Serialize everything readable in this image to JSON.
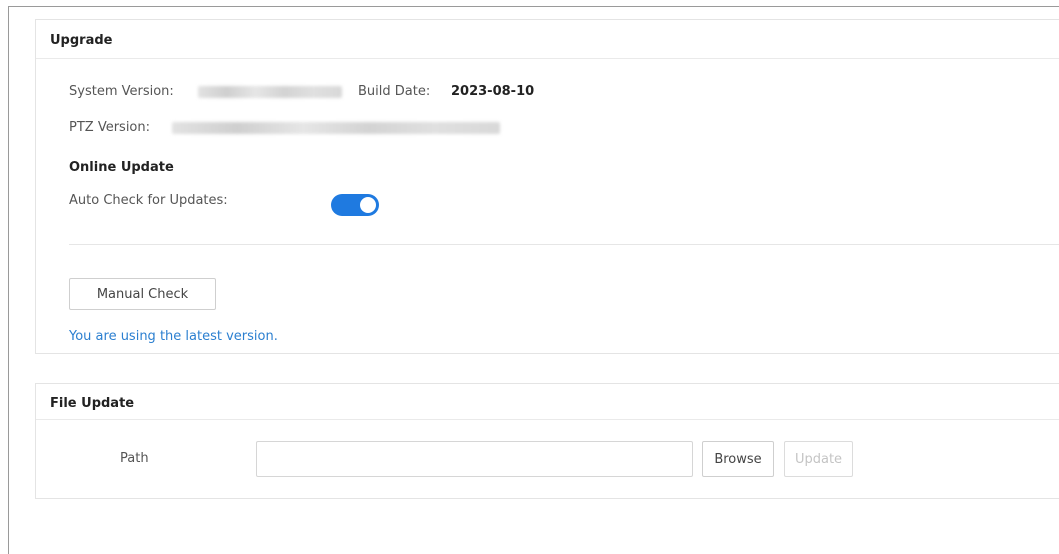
{
  "upgrade": {
    "title": "Upgrade",
    "system_version_label": "System Version:",
    "build_date_label": "Build Date:",
    "build_date_value": "2023-08-10",
    "ptz_version_label": "PTZ Version:",
    "online_update_heading": "Online Update",
    "auto_check_label": "Auto Check for Updates:",
    "auto_check_enabled": true,
    "manual_check_label": "Manual Check",
    "status_message": "You are using the latest version."
  },
  "file_update": {
    "title": "File Update",
    "path_label": "Path",
    "path_value": "",
    "browse_label": "Browse",
    "update_label": "Update"
  },
  "colors": {
    "accent": "#1f7ae0",
    "status_text": "#2b7fd0"
  }
}
